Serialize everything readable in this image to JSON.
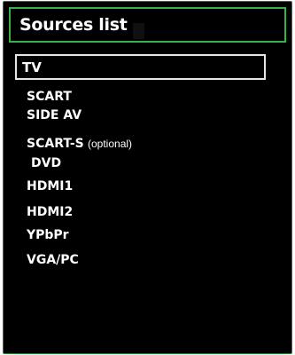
{
  "dialog": {
    "title": "Sources list"
  },
  "sources": {
    "selected": "TV",
    "items": [
      {
        "label": "SCART"
      },
      {
        "label": "SIDE AV"
      },
      {
        "label": "SCART-S"
      },
      {
        "label": "DVD"
      },
      {
        "label": "HDMI1"
      },
      {
        "label": "HDMI2"
      },
      {
        "label": "YPbPr"
      },
      {
        "label": "VGA/PC"
      }
    ],
    "optional_note": "(optional)"
  },
  "colors": {
    "background": "#000000",
    "frame_border": "#2f7d3c",
    "title_border": "#38b04c",
    "selection_border": "#e6e6e6",
    "text": "#ffffff"
  }
}
